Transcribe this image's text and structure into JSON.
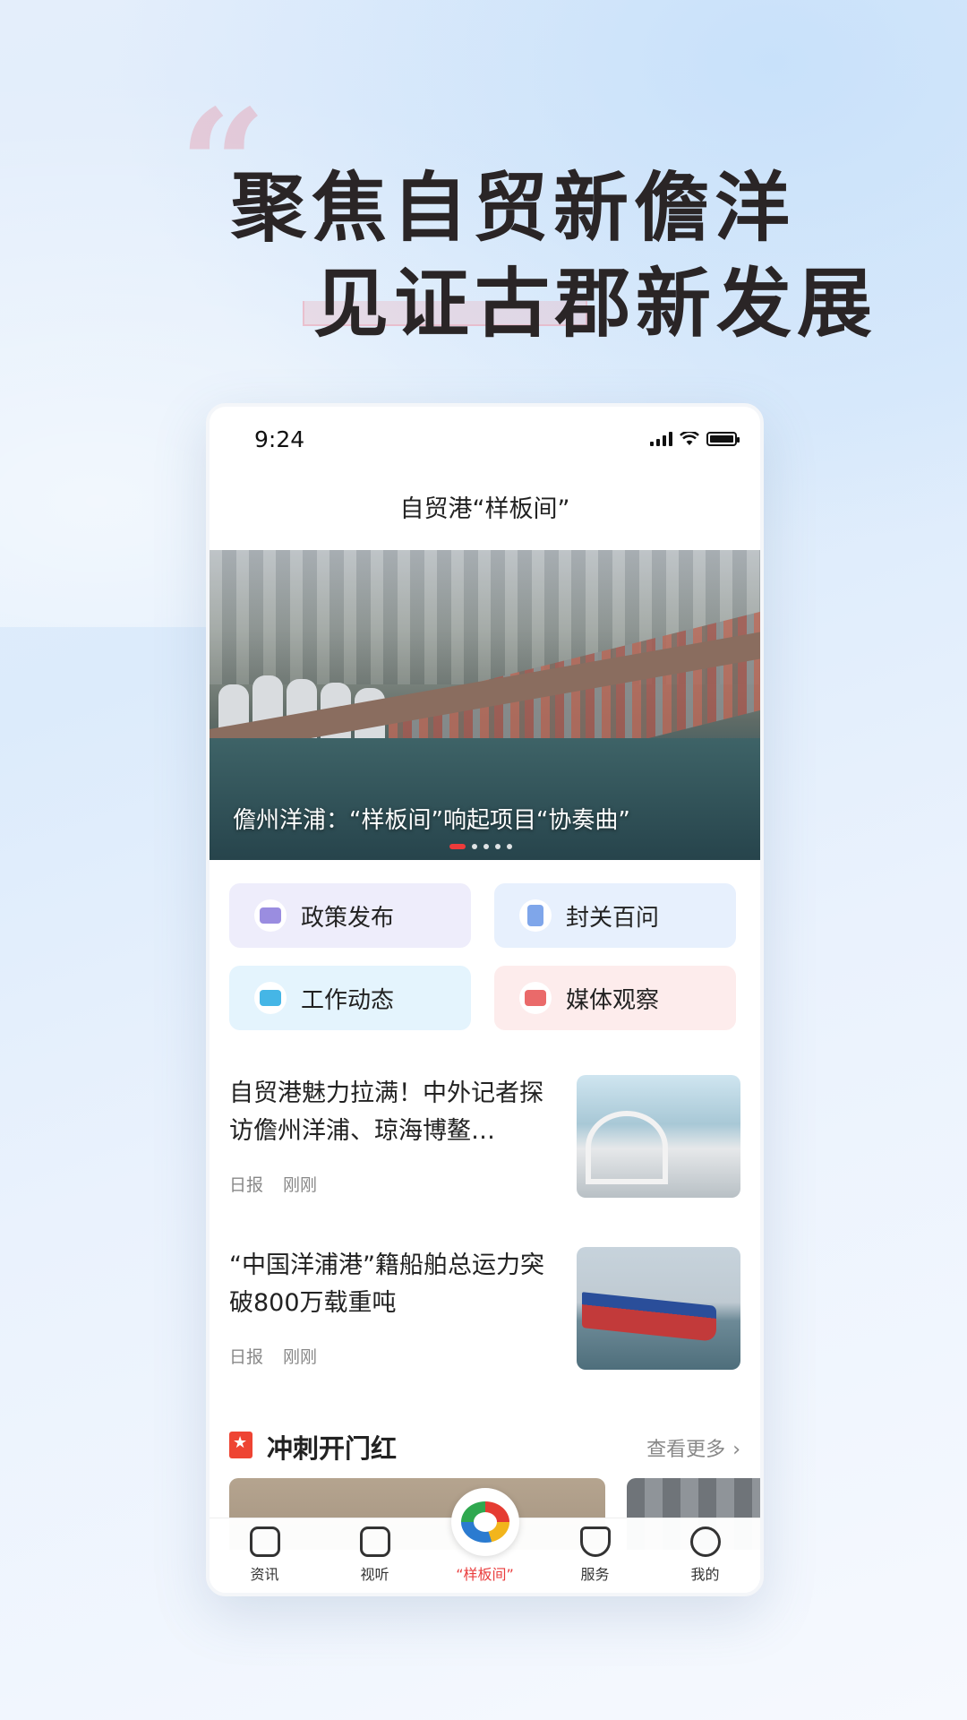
{
  "promo": {
    "quote_mark": "“",
    "headline_line1": "聚焦自贸新儋洋",
    "headline_line2": "见证古郡新发展"
  },
  "status_bar": {
    "time": "9:24",
    "icons": [
      "signal-icon",
      "wifi-icon",
      "battery-icon"
    ]
  },
  "page": {
    "title": "自贸港“样板间”"
  },
  "hero": {
    "caption": "儋州洋浦：“样板间”响起项目“协奏曲”",
    "slide_count": 5,
    "active_slide": 1
  },
  "quick_links": [
    {
      "label": "政策发布",
      "icon": "policy-video-icon"
    },
    {
      "label": "封关百问",
      "icon": "qa-book-icon"
    },
    {
      "label": "工作动态",
      "icon": "monitor-icon"
    },
    {
      "label": "媒体观察",
      "icon": "media-play-icon"
    }
  ],
  "news": [
    {
      "title": "自贸港魅力拉满！中外记者探访儋州洋浦、琼海博鳌…",
      "source": "日报",
      "time": "刚刚"
    },
    {
      "title": "“中国洋浦港”籍船舶总运力突破800万载重吨",
      "source": "日报",
      "time": "刚刚"
    }
  ],
  "section": {
    "title": "冲刺开门红",
    "more": "查看更多",
    "more_icon": "chevron-right-icon"
  },
  "tabbar": [
    {
      "label": "资讯",
      "icon": "news-icon"
    },
    {
      "label": "视听",
      "icon": "play-icon"
    },
    {
      "label": "“样板间”",
      "icon": "logo-icon",
      "active": true
    },
    {
      "label": "服务",
      "icon": "service-icon"
    },
    {
      "label": "我的",
      "icon": "profile-icon"
    }
  ],
  "colors": {
    "accent": "#e93c3c",
    "section_icon": "#ee4433"
  }
}
